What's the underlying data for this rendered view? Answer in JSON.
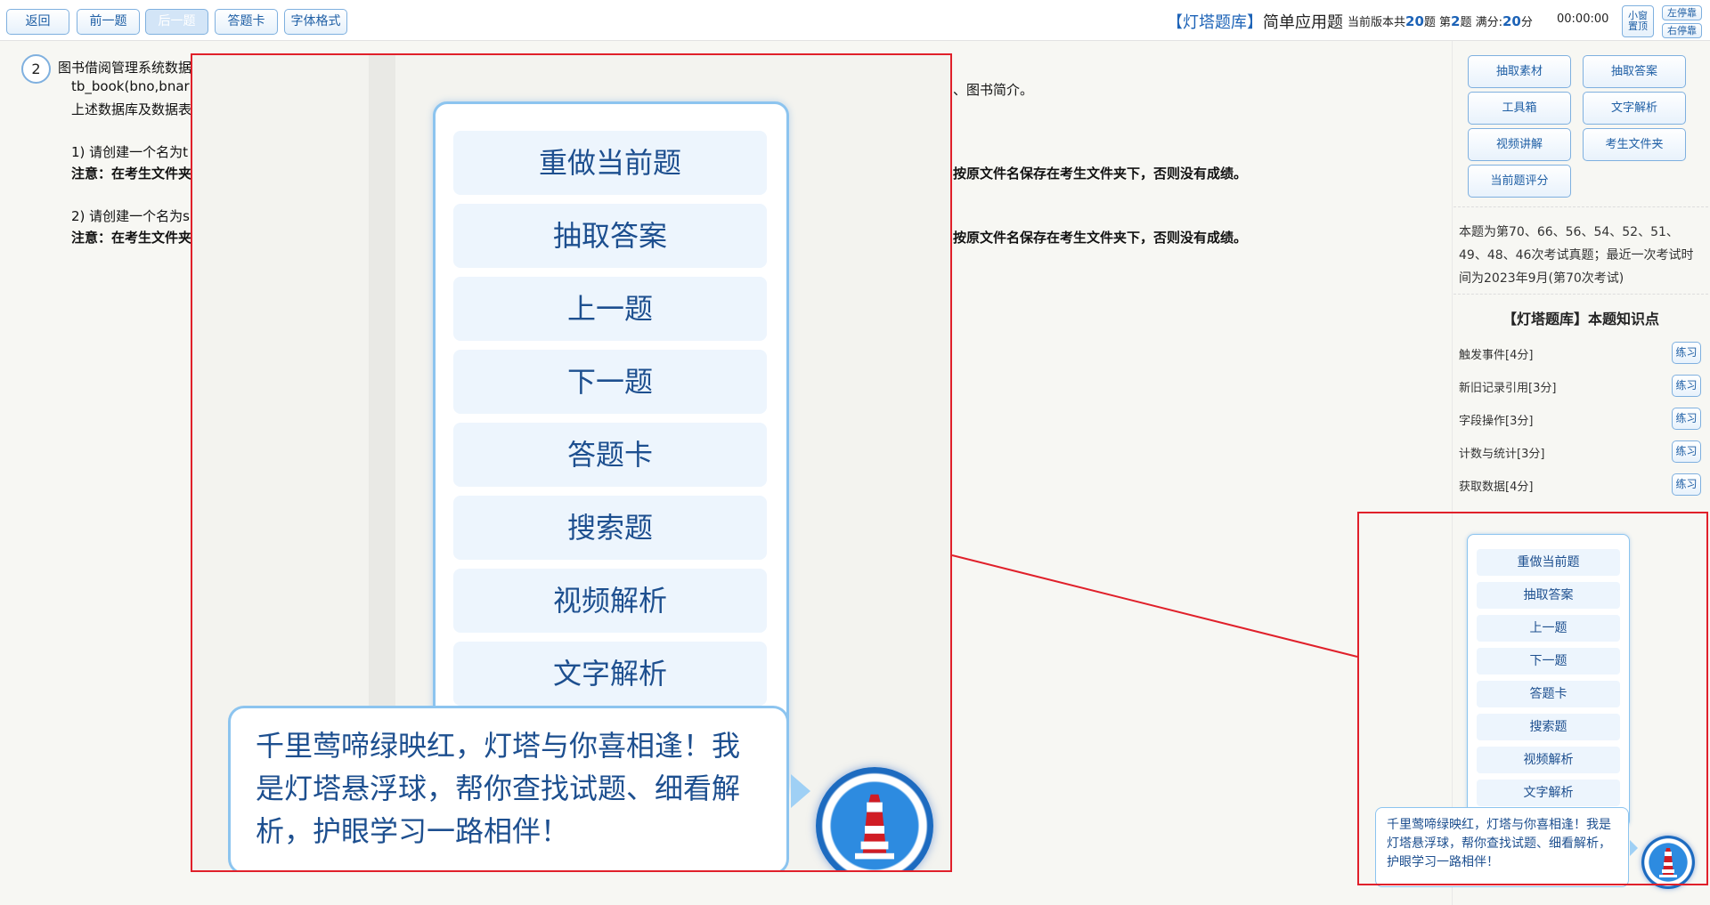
{
  "toolbar": {
    "buttons": [
      "返回",
      "前一题",
      "后一题",
      "答题卡",
      "字体格式"
    ],
    "title_brand": "【灯塔题库】",
    "title_text": "简单应用题",
    "meta_prefix": "当前版本共",
    "meta_total": "20",
    "meta_mid": "题 第",
    "meta_index": "2",
    "meta_score_label": "题 满分:",
    "meta_score": "20",
    "meta_score_unit": "分",
    "timer": "00:00:00",
    "small_window": [
      "小窗",
      "置顶"
    ],
    "dock_left": "左停靠",
    "dock_right": "右停靠"
  },
  "question": {
    "number": "2",
    "line1": "图书借阅管理系统数据",
    "line2": "tb_book(bno,bnar",
    "line2_tail": "、图书简介。",
    "line3": "上述数据库及数据表",
    "item1": "1) 请创建一个名为t",
    "item1_note": "注意：在考生文件夹",
    "item1_note_tail": "按原文件名保存在考生文件夹下，否则没有成绩。",
    "item2": "2) 请创建一个名为s",
    "item2_note": "注意：在考生文件夹",
    "item2_note_tail": "按原文件名保存在考生文件夹下，否则没有成绩。"
  },
  "right_panel": {
    "buttons": [
      "抽取素材",
      "抽取答案",
      "工具箱",
      "文字解析",
      "视频讲解",
      "考生文件夹",
      "当前题评分"
    ],
    "history": "本题为第70、66、56、54、52、51、49、48、46次考试真题；最近一次考试时间为2023年9月(第70次考试)",
    "knowledge_title": "【灯塔题库】本题知识点",
    "knowledge_points": [
      {
        "name": "触发事件[4分]",
        "action": "练习"
      },
      {
        "name": "新旧记录引用[3分]",
        "action": "练习"
      },
      {
        "name": "字段操作[3分]",
        "action": "练习"
      },
      {
        "name": "计数与统计[3分]",
        "action": "练习"
      },
      {
        "name": "获取数据[4分]",
        "action": "练习"
      }
    ]
  },
  "float_menu": {
    "items": [
      "重做当前题",
      "抽取答案",
      "上一题",
      "下一题",
      "答题卡",
      "搜索题",
      "视频解析",
      "文字解析"
    ],
    "bubble": "千里莺啼绿映红，灯塔与你喜相逢！我是灯塔悬浮球，帮你查找试题、细看解析，护眼学习一路相伴！"
  },
  "colors": {
    "brand_blue": "#1d63b7",
    "button_border": "#7fb0df",
    "menu_text": "#1d4f8f",
    "highlight_red": "#e0202a"
  }
}
